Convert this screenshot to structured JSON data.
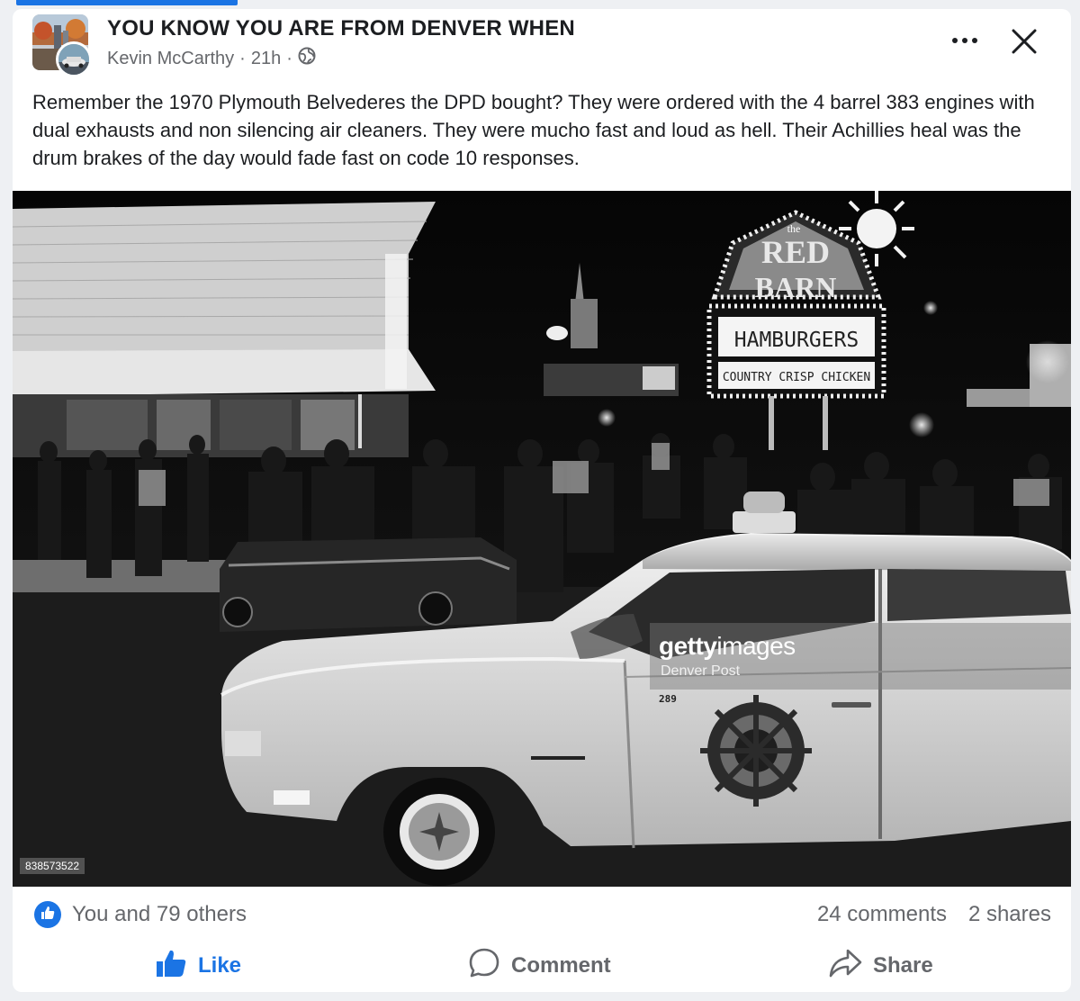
{
  "post": {
    "group_name": "YOU KNOW YOU ARE FROM DENVER WHEN",
    "author": "Kevin McCarthy",
    "separator": "·",
    "time": "21h",
    "text": "Remember the 1970 Plymouth Belvederes the DPD bought? They were ordered with the 4 barrel 383 engines with dual exhausts and non silencing air cleaners. They were mucho fast and loud as hell. Their Achillies heal was the drum brakes of the day would fade fast on code 10 responses."
  },
  "photo": {
    "sign_top": "the",
    "sign_red": "RED",
    "sign_barn": "BARN",
    "sign_hamburgers": "HAMBURGERS",
    "sign_chicken": "COUNTRY CRISP CHICKEN",
    "car_number": "289",
    "watermark_brand_bold": "getty",
    "watermark_brand_light": "images",
    "watermark_credit": "Denver Post",
    "image_id": "838573522"
  },
  "stats": {
    "reactions": "You and 79 others",
    "comments": "24 comments",
    "shares": "2 shares"
  },
  "actions": {
    "like": "Like",
    "comment": "Comment",
    "share": "Share"
  },
  "colors": {
    "accent": "#1b74e4",
    "text": "#1c1e21",
    "muted": "#65676b"
  },
  "icons": [
    "more-icon",
    "close-icon",
    "globe-icon",
    "like-icon",
    "comment-icon",
    "share-icon"
  ]
}
